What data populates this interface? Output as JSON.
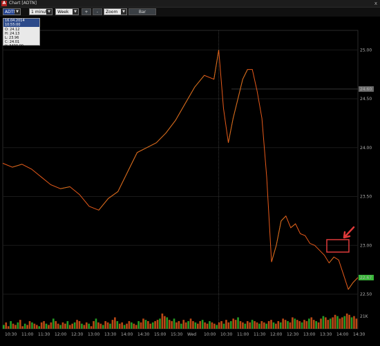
{
  "window": {
    "title": "Chart [ADTN]",
    "icon": "app-logo-icon",
    "close_glyph": "x"
  },
  "toolbar": {
    "symbol": "ADTN",
    "interval": "1 minute",
    "range": "Week",
    "zoom_in": "+",
    "zoom_out": "-",
    "zoom_mode": "Zoom",
    "chart_type": "Bar"
  },
  "ohlc_box": {
    "date": "16.04.2014 10:55:00",
    "open": "O: 24.12",
    "high": "H: 24.13",
    "low": "L: 23.96",
    "close": "C: 24.01",
    "volume": "V: 3400.00"
  },
  "colors": {
    "up": "#2ec22e",
    "down": "#e85a1a",
    "accent": "#e03a3a",
    "last_price": "#39b839"
  },
  "chart_data": {
    "type": "line",
    "symbol": "ADTN",
    "y_ticks": [
      "25.00",
      "24.50",
      "24.00",
      "23.50",
      "23.00",
      "22.50"
    ],
    "ylim": [
      22.5,
      25.2
    ],
    "x_ticks": [
      "10:30",
      "11:00",
      "11:30",
      "12:00",
      "12:30",
      "13:00",
      "13:30",
      "14:00",
      "14:30",
      "15:00",
      "15:30",
      "Wed",
      "10:00",
      "10:30",
      "11:00",
      "11:30",
      "12:00",
      "12:30",
      "13:00",
      "13:30",
      "14:00",
      "14:30"
    ],
    "price_labels": {
      "marker": "24.60",
      "last": "22.67"
    },
    "marker_price": 24.6,
    "last_price": 22.67,
    "volume_label": "21K",
    "price_path": [
      [
        0,
        23.84
      ],
      [
        4,
        23.8
      ],
      [
        8,
        23.83
      ],
      [
        12,
        23.78
      ],
      [
        16,
        23.7
      ],
      [
        20,
        23.62
      ],
      [
        24,
        23.58
      ],
      [
        28,
        23.6
      ],
      [
        32,
        23.52
      ],
      [
        36,
        23.4
      ],
      [
        40,
        23.36
      ],
      [
        44,
        23.48
      ],
      [
        48,
        23.55
      ],
      [
        52,
        23.75
      ],
      [
        56,
        23.95
      ],
      [
        60,
        24.0
      ],
      [
        64,
        24.05
      ],
      [
        68,
        24.15
      ],
      [
        72,
        24.28
      ],
      [
        76,
        24.45
      ],
      [
        80,
        24.62
      ],
      [
        84,
        24.74
      ],
      [
        88,
        24.7
      ],
      [
        90,
        25.0
      ],
      [
        92,
        24.4
      ],
      [
        94,
        24.05
      ],
      [
        96,
        24.3
      ],
      [
        98,
        24.5
      ],
      [
        100,
        24.7
      ],
      [
        102,
        24.8
      ],
      [
        104,
        24.8
      ],
      [
        106,
        24.58
      ],
      [
        108,
        24.3
      ],
      [
        110,
        23.7
      ],
      [
        112,
        22.83
      ],
      [
        114,
        23.0
      ],
      [
        116,
        23.25
      ],
      [
        118,
        23.3
      ],
      [
        120,
        23.18
      ],
      [
        122,
        23.22
      ],
      [
        124,
        23.12
      ],
      [
        126,
        23.1
      ],
      [
        128,
        23.02
      ],
      [
        130,
        23.0
      ],
      [
        132,
        22.95
      ],
      [
        134,
        22.9
      ],
      [
        136,
        22.82
      ],
      [
        138,
        22.88
      ],
      [
        140,
        22.85
      ],
      [
        142,
        22.7
      ],
      [
        144,
        22.55
      ],
      [
        146,
        22.62
      ],
      [
        148,
        22.67
      ]
    ],
    "x_range": [
      0,
      148
    ],
    "volume": [
      3,
      5,
      2,
      6,
      4,
      3,
      5,
      7,
      2,
      4,
      3,
      6,
      5,
      4,
      3,
      2,
      5,
      6,
      4,
      3,
      5,
      8,
      6,
      4,
      3,
      5,
      4,
      6,
      3,
      4,
      5,
      7,
      6,
      4,
      3,
      5,
      4,
      2,
      6,
      8,
      5,
      4,
      3,
      6,
      5,
      4,
      7,
      9,
      6,
      4,
      5,
      3,
      4,
      6,
      5,
      4,
      3,
      6,
      5,
      8,
      7,
      6,
      4,
      5,
      6,
      7,
      8,
      12,
      10,
      9,
      7,
      6,
      8,
      5,
      6,
      4,
      7,
      5,
      6,
      8,
      6,
      5,
      4,
      6,
      7,
      5,
      4,
      6,
      5,
      4,
      3,
      5,
      6,
      4,
      7,
      5,
      6,
      8,
      7,
      9,
      6,
      5,
      4,
      6,
      5,
      7,
      6,
      5,
      4,
      6,
      5,
      4,
      6,
      7,
      5,
      4,
      6,
      5,
      8,
      7,
      6,
      5,
      9,
      8,
      7,
      6,
      5,
      7,
      6,
      8,
      9,
      7,
      6,
      5,
      8,
      10,
      9,
      7,
      8,
      9,
      11,
      10,
      8,
      9,
      10,
      12,
      11,
      9,
      10,
      8
    ]
  }
}
